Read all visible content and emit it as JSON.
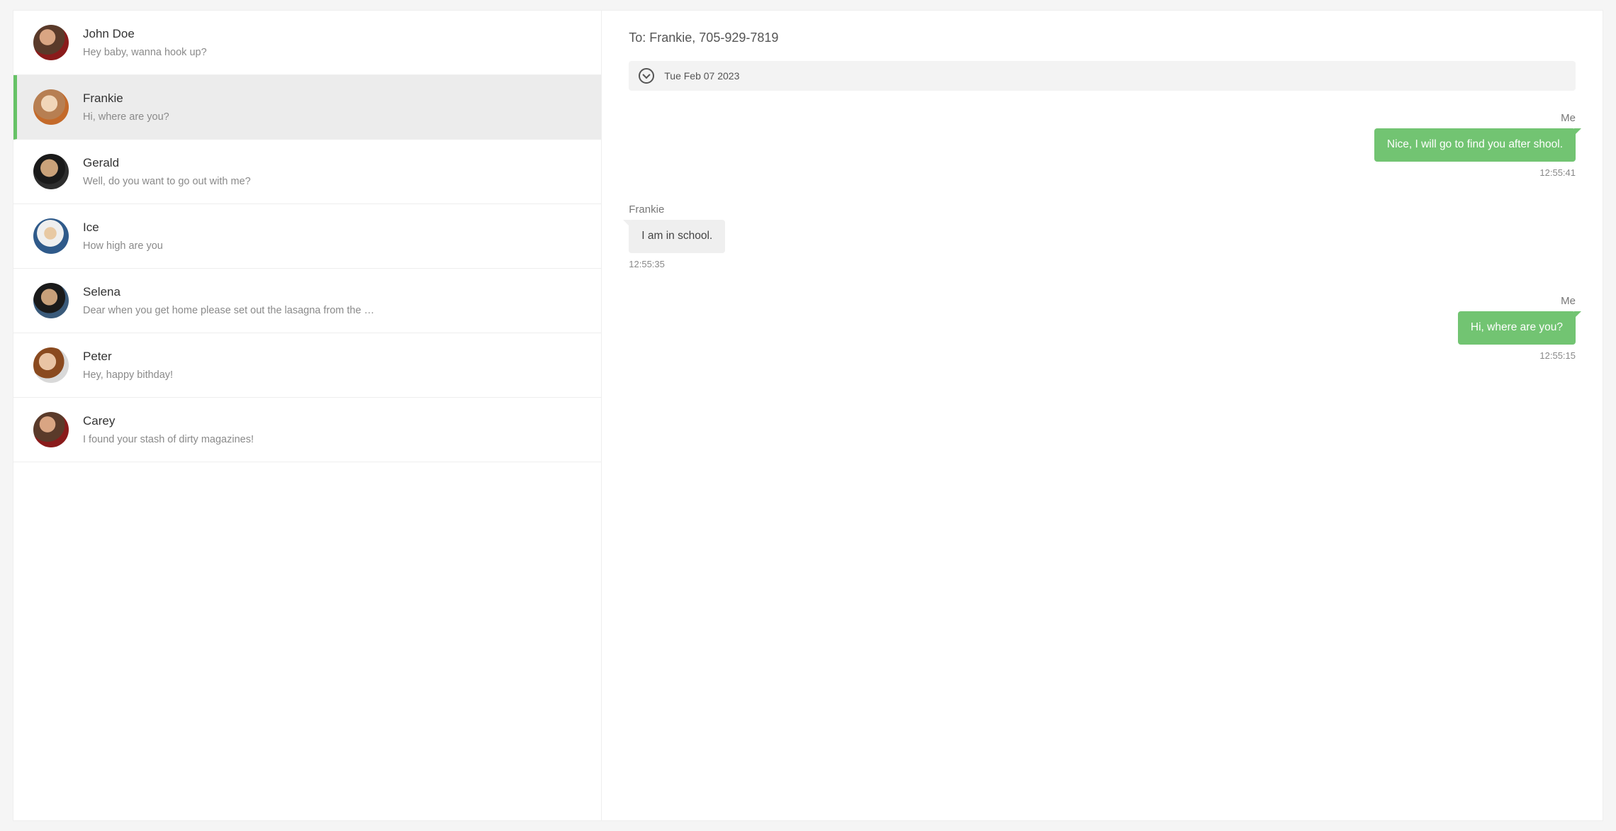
{
  "sidebar": {
    "contacts": [
      {
        "name": "John Doe",
        "preview": "Hey baby, wanna hook up?",
        "active": false,
        "avatarClass": "av-johndoe"
      },
      {
        "name": "Frankie",
        "preview": "Hi, where are you?",
        "active": true,
        "avatarClass": "av-frankie"
      },
      {
        "name": "Gerald",
        "preview": "Well, do you want to go out with me?",
        "active": false,
        "avatarClass": "av-gerald"
      },
      {
        "name": "Ice",
        "preview": "How high are you",
        "active": false,
        "avatarClass": "av-ice"
      },
      {
        "name": "Selena",
        "preview": "Dear when you get home please set out the lasagna from the …",
        "active": false,
        "avatarClass": "av-selena"
      },
      {
        "name": "Peter",
        "preview": "Hey, happy bithday!",
        "active": false,
        "avatarClass": "av-peter"
      },
      {
        "name": "Carey",
        "preview": "I found your stash of dirty magazines!",
        "active": false,
        "avatarClass": "av-carey"
      }
    ]
  },
  "chat": {
    "to_label": "To: Frankie, 705-929-7819",
    "date_label": "Tue Feb 07 2023",
    "me_label": "Me",
    "messages": [
      {
        "side": "me",
        "sender": "Me",
        "text": "Nice, I will go to find you after shool.",
        "time": "12:55:41"
      },
      {
        "side": "them",
        "sender": "Frankie",
        "text": "I am in school.",
        "time": "12:55:35"
      },
      {
        "side": "me",
        "sender": "Me",
        "text": "Hi, where are you?",
        "time": "12:55:15"
      }
    ]
  }
}
